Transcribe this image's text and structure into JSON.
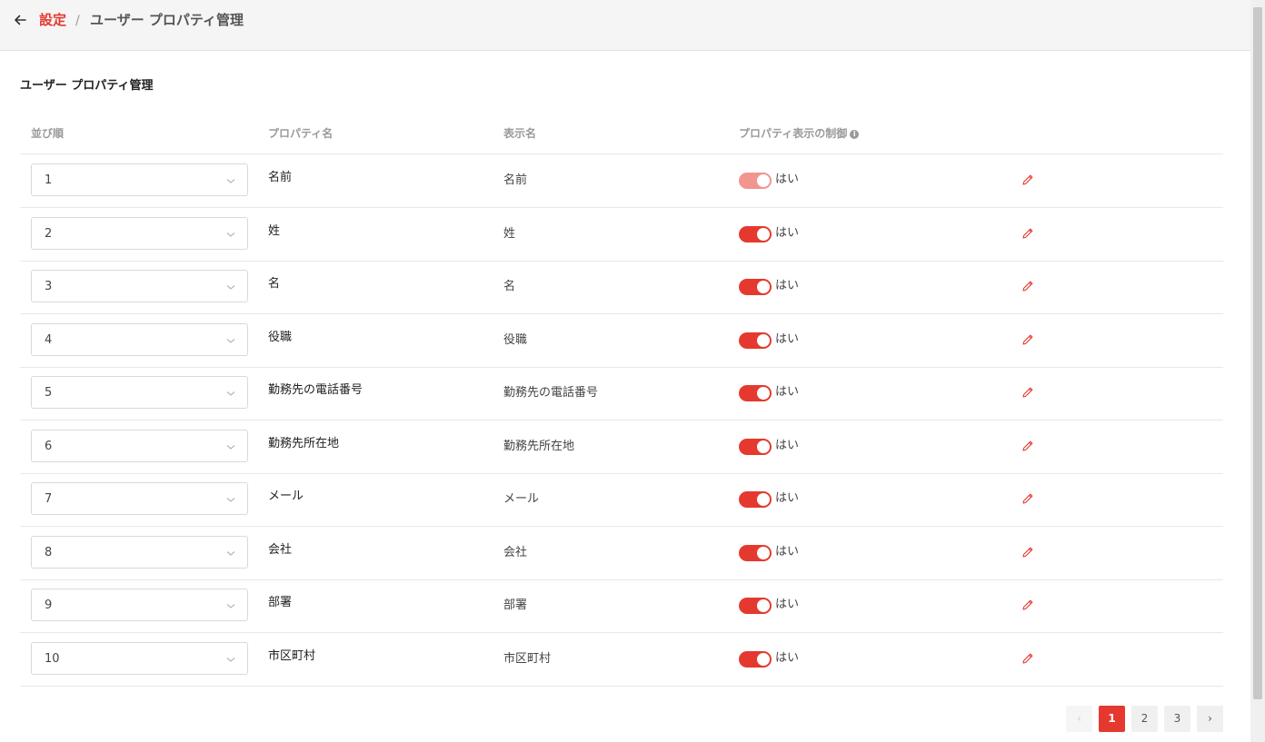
{
  "breadcrumb": {
    "root": "設定",
    "separator": "/",
    "current": "ユーザー プロパティ管理"
  },
  "page_title": "ユーザー プロパティ管理",
  "table": {
    "headers": {
      "order": "並び順",
      "property_name": "プロパティ名",
      "display_name": "表示名",
      "visibility": "プロパティ表示の制御"
    },
    "rows": [
      {
        "order": "1",
        "property_name": "名前",
        "display_name": "名前",
        "toggle_label": "はい",
        "enabled": true,
        "locked": true
      },
      {
        "order": "2",
        "property_name": "姓",
        "display_name": "姓",
        "toggle_label": "はい",
        "enabled": true,
        "locked": false
      },
      {
        "order": "3",
        "property_name": "名",
        "display_name": "名",
        "toggle_label": "はい",
        "enabled": true,
        "locked": false
      },
      {
        "order": "4",
        "property_name": "役職",
        "display_name": "役職",
        "toggle_label": "はい",
        "enabled": true,
        "locked": false
      },
      {
        "order": "5",
        "property_name": "勤務先の電話番号",
        "display_name": "勤務先の電話番号",
        "toggle_label": "はい",
        "enabled": true,
        "locked": false
      },
      {
        "order": "6",
        "property_name": "勤務先所在地",
        "display_name": "勤務先所在地",
        "toggle_label": "はい",
        "enabled": true,
        "locked": false
      },
      {
        "order": "7",
        "property_name": "メール",
        "display_name": "メール",
        "toggle_label": "はい",
        "enabled": true,
        "locked": false
      },
      {
        "order": "8",
        "property_name": "会社",
        "display_name": "会社",
        "toggle_label": "はい",
        "enabled": true,
        "locked": false
      },
      {
        "order": "9",
        "property_name": "部署",
        "display_name": "部署",
        "toggle_label": "はい",
        "enabled": true,
        "locked": false
      },
      {
        "order": "10",
        "property_name": "市区町村",
        "display_name": "市区町村",
        "toggle_label": "はい",
        "enabled": true,
        "locked": false
      }
    ]
  },
  "pagination": {
    "prev": "‹",
    "next": "›",
    "pages": [
      "1",
      "2",
      "3"
    ],
    "current": "1"
  },
  "colors": {
    "accent": "#e5392f",
    "accent_disabled": "#f2958e"
  },
  "icons": {
    "back": "arrow-left-icon",
    "select": "chevron-down-icon",
    "edit": "pencil-icon",
    "info": "info-icon"
  }
}
